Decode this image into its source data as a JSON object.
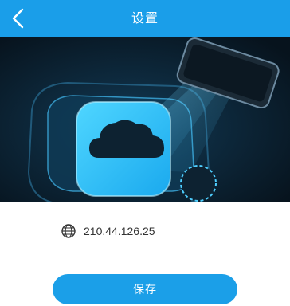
{
  "header": {
    "title": "设置",
    "back_icon": "chevron-left-icon"
  },
  "hero": {
    "image": "cloud-server-illustration"
  },
  "server": {
    "ip_value": "210.44.126.25",
    "icon": "globe-icon"
  },
  "actions": {
    "save_label": "保存"
  },
  "colors": {
    "accent": "#1a9ee9",
    "hero_dark": "#0b1b2a"
  }
}
